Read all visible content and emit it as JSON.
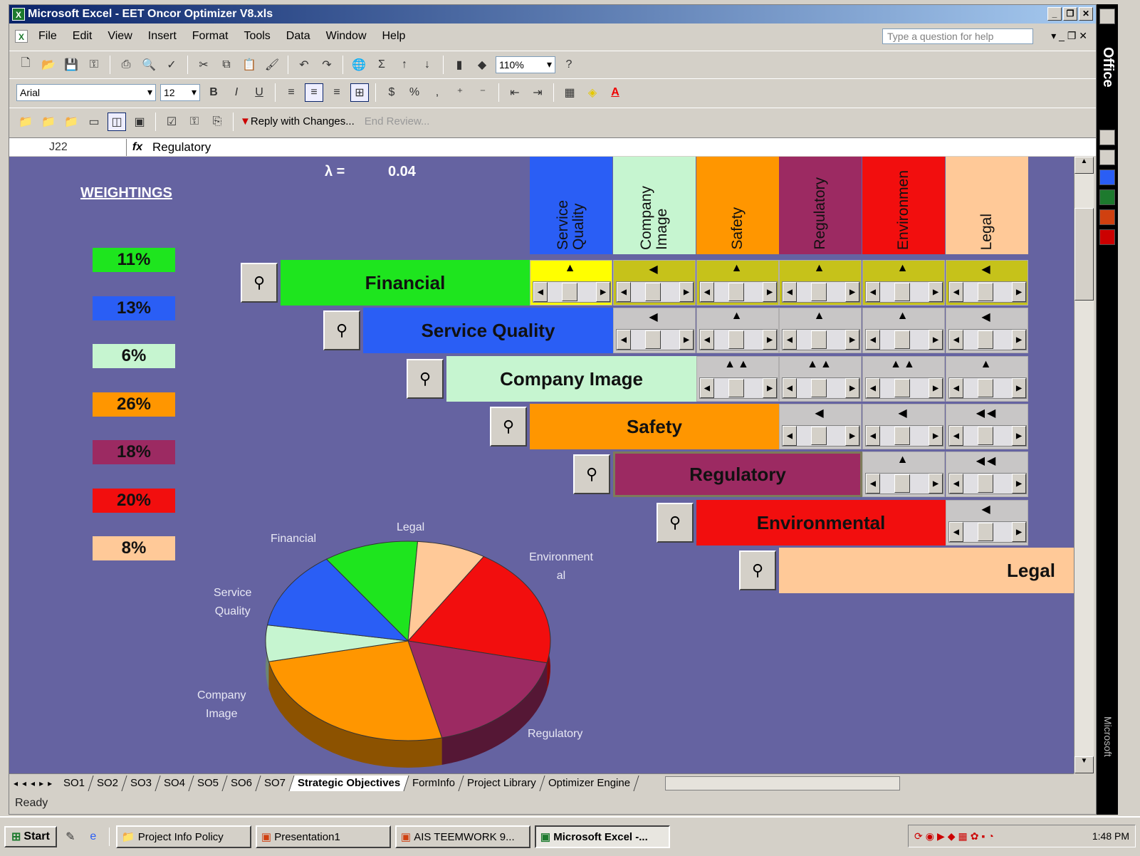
{
  "window": {
    "title": "Microsoft Excel - EET Oncor Optimizer V8.xls"
  },
  "menu": [
    "File",
    "Edit",
    "View",
    "Insert",
    "Format",
    "Tools",
    "Data",
    "Window",
    "Help"
  ],
  "help_placeholder": "Type a question for help",
  "toolbar": {
    "zoom": "110%",
    "font": "Arial",
    "font_size": "12",
    "reply": "Reply with Changes...",
    "end_review": "End Review..."
  },
  "formula": {
    "name_box": "J22",
    "fx": "fx",
    "content": "Regulatory"
  },
  "sheet": {
    "weightings_title": "WEIGHTINGS",
    "lambda_label": "λ =",
    "lambda_value": "0.04",
    "weights": [
      {
        "value": "11%",
        "color": "#1ee51e"
      },
      {
        "value": "13%",
        "color": "#2a5ef5"
      },
      {
        "value": "6%",
        "color": "#c6f5d0"
      },
      {
        "value": "26%",
        "color": "#ff9600"
      },
      {
        "value": "18%",
        "color": "#9c2a62"
      },
      {
        "value": "20%",
        "color": "#f20e0e"
      },
      {
        "value": "8%",
        "color": "#ffc998"
      }
    ],
    "columns": [
      {
        "label": "Service Quality",
        "color": "#2a5ef5"
      },
      {
        "label": "Company Image",
        "color": "#c6f5d0"
      },
      {
        "label": "Safety",
        "color": "#ff9600"
      },
      {
        "label": "Regulatory",
        "color": "#9c2a62"
      },
      {
        "label": "Environmen",
        "color": "#f20e0e"
      },
      {
        "label": "Legal",
        "color": "#ffc998"
      }
    ],
    "rows": [
      {
        "label": "Financial",
        "color": "#1ee51e"
      },
      {
        "label": "Service Quality",
        "color": "#2a5ef5"
      },
      {
        "label": "Company Image",
        "color": "#c6f5d0"
      },
      {
        "label": "Safety",
        "color": "#ff9600"
      },
      {
        "label": "Regulatory",
        "color": "#9c2a62"
      },
      {
        "label": "Environmental",
        "color": "#f20e0e"
      },
      {
        "label": "Legal",
        "color": "#ffc998"
      }
    ],
    "comparisons": [
      [
        "▲",
        "◀",
        "▲",
        "▲",
        "▲",
        "◀"
      ],
      [
        "◀",
        "▲",
        "▲",
        "▲",
        "◀"
      ],
      [
        "▲▲",
        "▲▲",
        "▲▲",
        "▲"
      ],
      [
        "◀",
        "◀",
        "◀◀"
      ],
      [
        "▲",
        "◀◀"
      ],
      [
        "◀"
      ]
    ],
    "magnifier_icon": "⚲"
  },
  "pie": {
    "labels": [
      "Financial",
      "Legal",
      "Environmental",
      "Service Quality",
      "Company Image",
      "Regulatory"
    ],
    "label_text": {
      "financial": "Financial",
      "legal": "Legal",
      "env1": "Environment",
      "env2": "al",
      "sq1": "Service",
      "sq2": "Quality",
      "ci1": "Company",
      "ci2": "Image",
      "reg": "Regulatory"
    }
  },
  "chart_data": {
    "type": "pie",
    "categories": [
      "Financial",
      "Service Quality",
      "Company Image",
      "Safety",
      "Regulatory",
      "Environmental",
      "Legal"
    ],
    "values": [
      11,
      13,
      6,
      26,
      18,
      20,
      8
    ],
    "colors": [
      "#1ee51e",
      "#2a5ef5",
      "#c6f5d0",
      "#ff9600",
      "#9c2a62",
      "#f20e0e",
      "#ffc998"
    ]
  },
  "tabs": [
    "SO1",
    "SO2",
    "SO3",
    "SO4",
    "SO5",
    "SO6",
    "SO7",
    "Strategic Objectives",
    "FormInfo",
    "Project Library",
    "Optimizer Engine"
  ],
  "active_tab": "Strategic Objectives",
  "status": "Ready",
  "taskbar": {
    "start": "Start",
    "tasks": [
      "Project Info Policy",
      "Presentation1",
      "AIS TEEMWORK 9...",
      "Microsoft Excel -..."
    ],
    "clock": "1:48 PM"
  },
  "side_label": "Office",
  "side_label2": "Microsoft"
}
